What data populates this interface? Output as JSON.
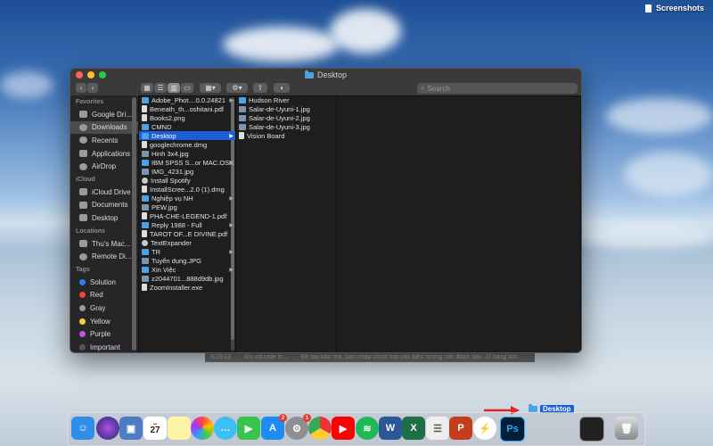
{
  "desktop": {
    "screenshots_label": "Screenshots"
  },
  "window": {
    "title": "Desktop",
    "search_placeholder": "Search"
  },
  "sidebar": {
    "favorites_header": "Favorites",
    "favorites": [
      "Google Dri...",
      "Downloads",
      "Recents",
      "Applications",
      "AirDrop"
    ],
    "icloud_header": "iCloud",
    "icloud": [
      "iCloud Drive",
      "Documents",
      "Desktop"
    ],
    "locations_header": "Locations",
    "locations": [
      "Thu's Mac...",
      "Remote Di..."
    ],
    "tags_header": "Tags",
    "tags": [
      {
        "label": "Solution",
        "color": "#2f7df6"
      },
      {
        "label": "Red",
        "color": "#f0453a"
      },
      {
        "label": "Gray",
        "color": "#9a9a9a"
      },
      {
        "label": "Yellow",
        "color": "#f4d03a"
      },
      {
        "label": "Purple",
        "color": "#c154e0"
      },
      {
        "label": "Important",
        "color": "#555555"
      }
    ]
  },
  "column1": [
    {
      "name": "Adobe_Phot....0.0.24821",
      "icon": "folder",
      "arrow": true
    },
    {
      "name": "Beneath_th...oshitani.pdf",
      "icon": "file"
    },
    {
      "name": "Books2.png",
      "icon": "file"
    },
    {
      "name": "CMND",
      "icon": "folder"
    },
    {
      "name": "Desktop",
      "icon": "folder",
      "arrow": true,
      "selected": true
    },
    {
      "name": "googlechrome.dmg",
      "icon": "file"
    },
    {
      "name": "Hinh 3x4.jpg",
      "icon": "img"
    },
    {
      "name": "IBM SPSS S...or MAC.OSX",
      "icon": "folder",
      "arrow": true
    },
    {
      "name": "IMG_4231.jpg",
      "icon": "img"
    },
    {
      "name": "Install Spotify",
      "icon": "app"
    },
    {
      "name": "InstallScree...2.0 (1).dmg",
      "icon": "file"
    },
    {
      "name": "Nghiệp vụ NH",
      "icon": "folder",
      "arrow": true
    },
    {
      "name": "PEW.jpg",
      "icon": "img"
    },
    {
      "name": "PHA-CHE-LEGEND-1.pdf",
      "icon": "file"
    },
    {
      "name": "Reply 1988 - Full",
      "icon": "folder",
      "arrow": true
    },
    {
      "name": "TAROT OF...E DIVINE.pdf",
      "icon": "file"
    },
    {
      "name": "TextExpander",
      "icon": "app"
    },
    {
      "name": "TR",
      "icon": "folder",
      "arrow": true
    },
    {
      "name": "Tuyển dụng.JPG",
      "icon": "img"
    },
    {
      "name": "Xin Việc",
      "icon": "folder",
      "arrow": true
    },
    {
      "name": "z2044701...888d9db.jpg",
      "icon": "img"
    },
    {
      "name": "ZoomInstaller.exe",
      "icon": "file"
    }
  ],
  "column2": [
    {
      "name": "Hudson River",
      "icon": "folder"
    },
    {
      "name": "Salar-de-Uyuni-1.jpg",
      "icon": "img"
    },
    {
      "name": "Salar-de-Uyuni-2.jpg",
      "icon": "img"
    },
    {
      "name": "Salar-de-Uyuni-3.jpg",
      "icon": "img"
    },
    {
      "name": "Vision Board",
      "icon": "file"
    }
  ],
  "ghost_row": {
    "date": "8/29/18",
    "name": "Wo vduyide m...",
    "text": "Để tạo bảo mà, ban nhấp chuột trái vào biểu tượng cần đánh dấu. Ở bảng lịch..."
  },
  "dock": {
    "calendar_day": "27",
    "badge_appstore": "2",
    "badge_settings": "1",
    "drag_label": "Desktop",
    "ps_label": "Ps"
  },
  "colors": {
    "accent": "#1c5fd4",
    "folder": "#4aa3e6"
  }
}
